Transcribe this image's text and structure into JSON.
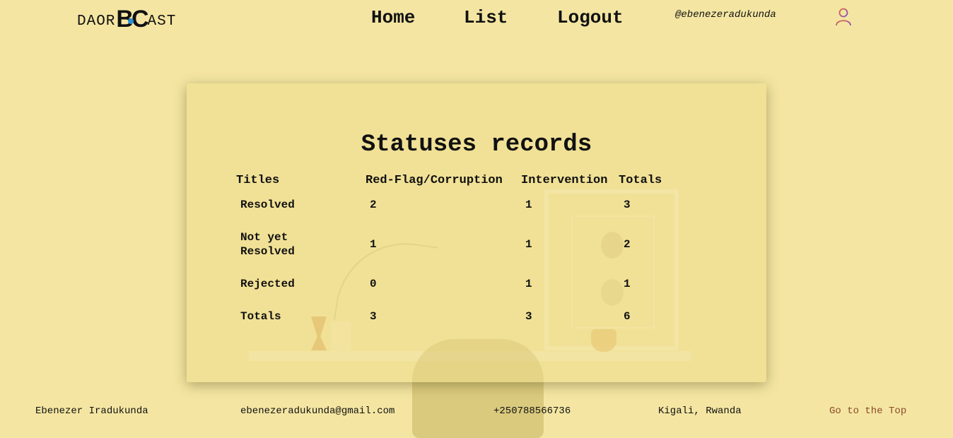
{
  "header": {
    "logo_left": "DAOR",
    "logo_mark": "BC",
    "logo_right": "AST",
    "nav": {
      "home": "Home",
      "list": "List",
      "logout": "Logout"
    },
    "username": "@ebenezeradukunda",
    "user_icon": "user-icon"
  },
  "main": {
    "title": "Statuses records",
    "columns": [
      "Titles",
      "Red-Flag/Corruption",
      "Intervention",
      "Totals"
    ],
    "rows": [
      {
        "title_line1": "Resolved",
        "title_line2": "",
        "redflag": "2",
        "intervention": "1",
        "total": "3"
      },
      {
        "title_line1": "Not yet",
        "title_line2": "Resolved",
        "redflag": "1",
        "intervention": "1",
        "total": "2"
      },
      {
        "title_line1": "Rejected",
        "title_line2": "",
        "redflag": "0",
        "intervention": "1",
        "total": "1"
      },
      {
        "title_line1": "Totals",
        "title_line2": "",
        "redflag": "3",
        "intervention": "3",
        "total": "6"
      }
    ]
  },
  "footer": {
    "name": "Ebenezer Iradukunda",
    "email": "ebenezeradukunda@gmail.com",
    "phone": "+250788566736",
    "location": "Kigali, Rwanda",
    "top_link": "Go to the Top"
  },
  "colors": {
    "background": "#f4e6a2",
    "accent_blue": "#2b8fd6",
    "top_link": "#8a4a2a"
  }
}
